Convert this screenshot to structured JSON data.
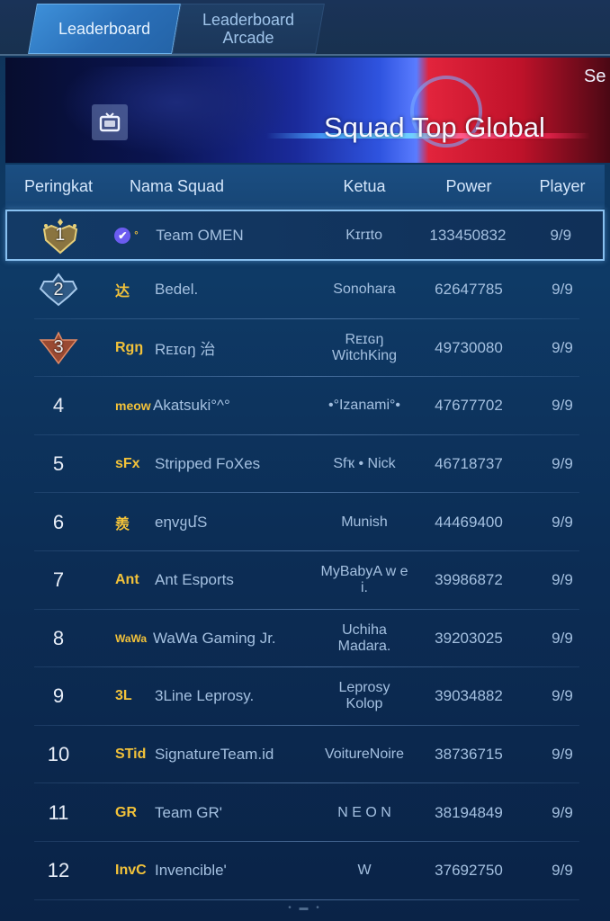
{
  "tabs": [
    {
      "label": "Leaderboard",
      "active": true
    },
    {
      "label": "Leaderboard Arcade",
      "active": false
    }
  ],
  "banner": {
    "title": "Squad Top Global",
    "season_label_partial": "Se",
    "tv_icon": "tv-icon"
  },
  "table": {
    "headers": {
      "rank": "Peringkat",
      "name": "Nama Squad",
      "ketua": "Ketua",
      "power": "Power",
      "player": "Player"
    },
    "rows": [
      {
        "rank": "1",
        "tag": "°",
        "verified": true,
        "name": "Team OMEN",
        "ketua": "Kɪrɪto",
        "power": "133450832",
        "player": "9/9",
        "badge": "gold"
      },
      {
        "rank": "2",
        "tag": "达",
        "name": "Bedel.",
        "ketua": "Sonohara",
        "power": "62647785",
        "player": "9/9",
        "badge": "silver"
      },
      {
        "rank": "3",
        "tag": "Rgŋ",
        "name": "Rᴇɪɢŋ 治",
        "ketua": "Rᴇɪɢŋ WitchKing",
        "power": "49730080",
        "player": "9/9",
        "badge": "bronze"
      },
      {
        "rank": "4",
        "tag": "meow",
        "name": "Akatsuki°^°",
        "ketua": "•°Izanami°•",
        "power": "47677702",
        "player": "9/9"
      },
      {
        "rank": "5",
        "tag": "sFx",
        "name": "Stripped FoXes",
        "ketua": "Sfҡ • Nick",
        "power": "46718737",
        "player": "9/9"
      },
      {
        "rank": "6",
        "tag": "羨",
        "name": "eηvყմS",
        "ketua": "Munish",
        "power": "44469400",
        "player": "9/9"
      },
      {
        "rank": "7",
        "tag": "Ant",
        "name": "Ant Esports",
        "ketua": "MyBabyA w e i.",
        "power": "39986872",
        "player": "9/9"
      },
      {
        "rank": "8",
        "tag": "WaWa",
        "name": "WaWa Gaming Jr.",
        "ketua": "Uchiha Madara.",
        "power": "39203025",
        "player": "9/9"
      },
      {
        "rank": "9",
        "tag": "3L",
        "name": "3Line Leprosy.",
        "ketua": "Leprosy Kolop",
        "power": "39034882",
        "player": "9/9"
      },
      {
        "rank": "10",
        "tag": "STid",
        "name": "SignatureTeam.id",
        "ketua": "VoitureNoire",
        "power": "38736715",
        "player": "9/9"
      },
      {
        "rank": "11",
        "tag": "GR",
        "name": "Team GR'",
        "ketua": "N E O N",
        "power": "38194849",
        "player": "9/9"
      },
      {
        "rank": "12",
        "tag": "InvC",
        "name": "Invencible'",
        "ketua": "W",
        "power": "37692750",
        "player": "9/9"
      }
    ]
  },
  "pager": "• ▬ •",
  "colors": {
    "accent_tag": "#f2c23a",
    "selected_border": "#88c0f0",
    "verified": "#6b5cf0"
  }
}
